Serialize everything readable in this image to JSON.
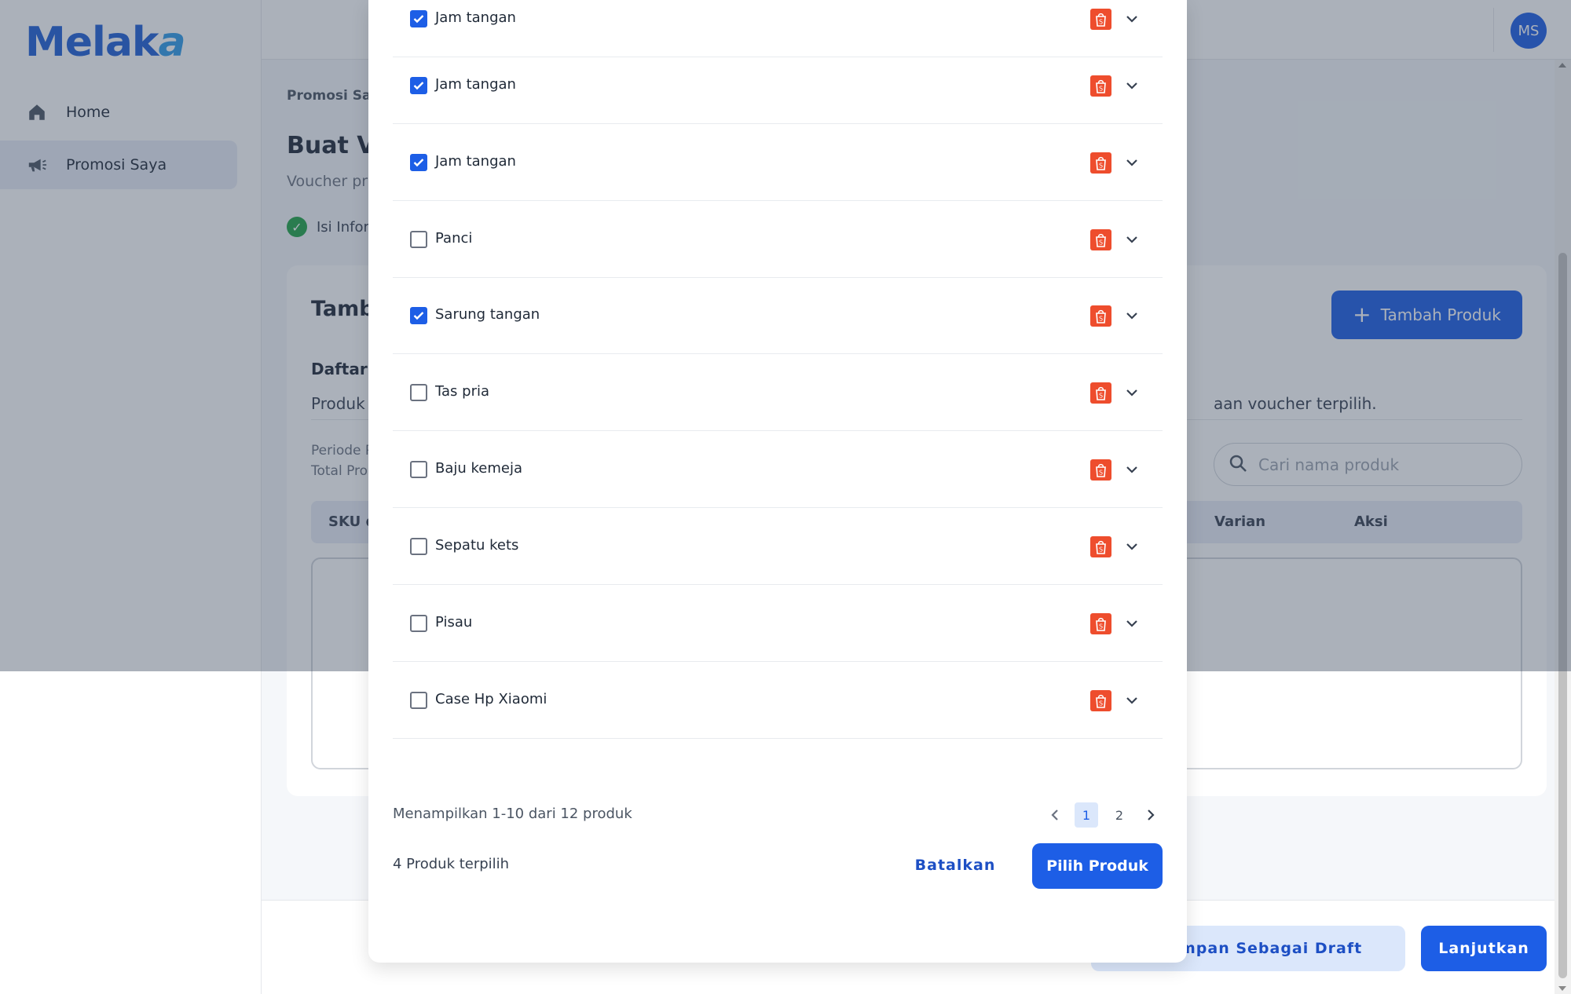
{
  "app": {
    "logo_main": "Melak",
    "logo_accent": "a"
  },
  "sidebar": {
    "items": [
      {
        "label": "Home",
        "icon": "home-icon"
      },
      {
        "label": "Promosi Saya",
        "icon": "megaphone-icon",
        "active": true
      }
    ]
  },
  "topbar": {
    "avatar_initials": "MS"
  },
  "main": {
    "breadcrumb": "Promosi Saya",
    "title": "Buat Voucher",
    "subtitle": "Voucher pr",
    "step_label": "Isi Inform",
    "card": {
      "title": "Tamb",
      "add_button": "Tambah Produk",
      "list_title": "Daftar P",
      "desc_left": "Produk",
      "desc_right": "aan voucher terpilih.",
      "meta_period": "Periode P",
      "meta_total": "Total Pro",
      "search_placeholder": "Cari nama produk",
      "columns": {
        "sku": "SKU d",
        "varian": "Varian",
        "aksi": "Aksi"
      }
    }
  },
  "bottom_actions": {
    "draft_button": "an Simpan Sebagai Draft",
    "next_button": "Lanjutkan"
  },
  "modal": {
    "products": [
      {
        "name": "Jam tangan",
        "checked": true,
        "marketplace": "shopee-icon"
      },
      {
        "name": "Jam tangan",
        "checked": true,
        "marketplace": "shopee-icon"
      },
      {
        "name": "Jam tangan",
        "checked": true,
        "marketplace": "shopee-icon"
      },
      {
        "name": "Panci",
        "checked": false,
        "marketplace": "shopee-icon"
      },
      {
        "name": "Sarung tangan",
        "checked": true,
        "marketplace": "shopee-icon"
      },
      {
        "name": "Tas pria",
        "checked": false,
        "marketplace": "shopee-icon"
      },
      {
        "name": "Baju kemeja",
        "checked": false,
        "marketplace": "shopee-icon"
      },
      {
        "name": "Sepatu kets",
        "checked": false,
        "marketplace": "shopee-icon"
      },
      {
        "name": "Pisau",
        "checked": false,
        "marketplace": "shopee-icon"
      },
      {
        "name": "Case Hp Xiaomi",
        "checked": false,
        "marketplace": "shopee-icon"
      }
    ],
    "pagination_text": "Menampilkan 1-10 dari 12 produk",
    "pages": [
      "1",
      "2"
    ],
    "current_page": "1",
    "selected_text": "4 Produk terpilih",
    "cancel_button": "Batalkan",
    "confirm_button": "Pilih Produk"
  },
  "colors": {
    "primary": "#1d5ee6",
    "shopee": "#ee4d2d",
    "success": "#22a447"
  }
}
